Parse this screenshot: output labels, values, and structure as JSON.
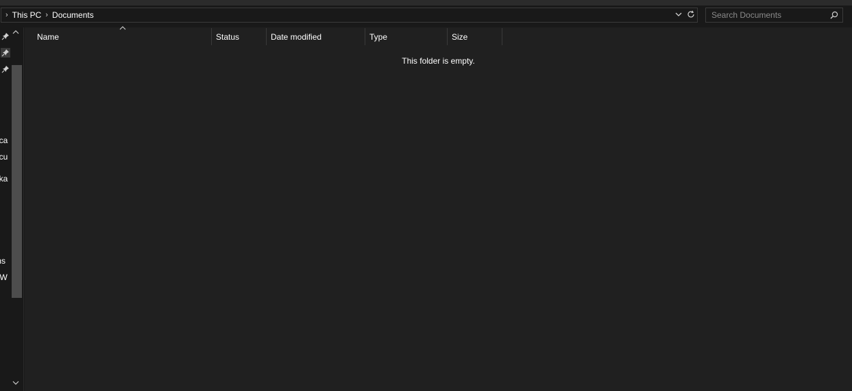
{
  "breadcrumb": {
    "items": [
      "This PC",
      "Documents"
    ]
  },
  "search": {
    "placeholder": "Search Documents"
  },
  "nav": {
    "partial_labels": [
      "hca",
      "ocu",
      "aka",
      "ms",
      "AW"
    ]
  },
  "columns": [
    "Name",
    "Status",
    "Date modified",
    "Type",
    "Size"
  ],
  "main": {
    "empty_message": "This folder is empty."
  },
  "colors": {
    "background": "#191919",
    "pane": "#202020",
    "border": "#3a3a3a",
    "scroll_thumb": "#4d4d4d"
  }
}
